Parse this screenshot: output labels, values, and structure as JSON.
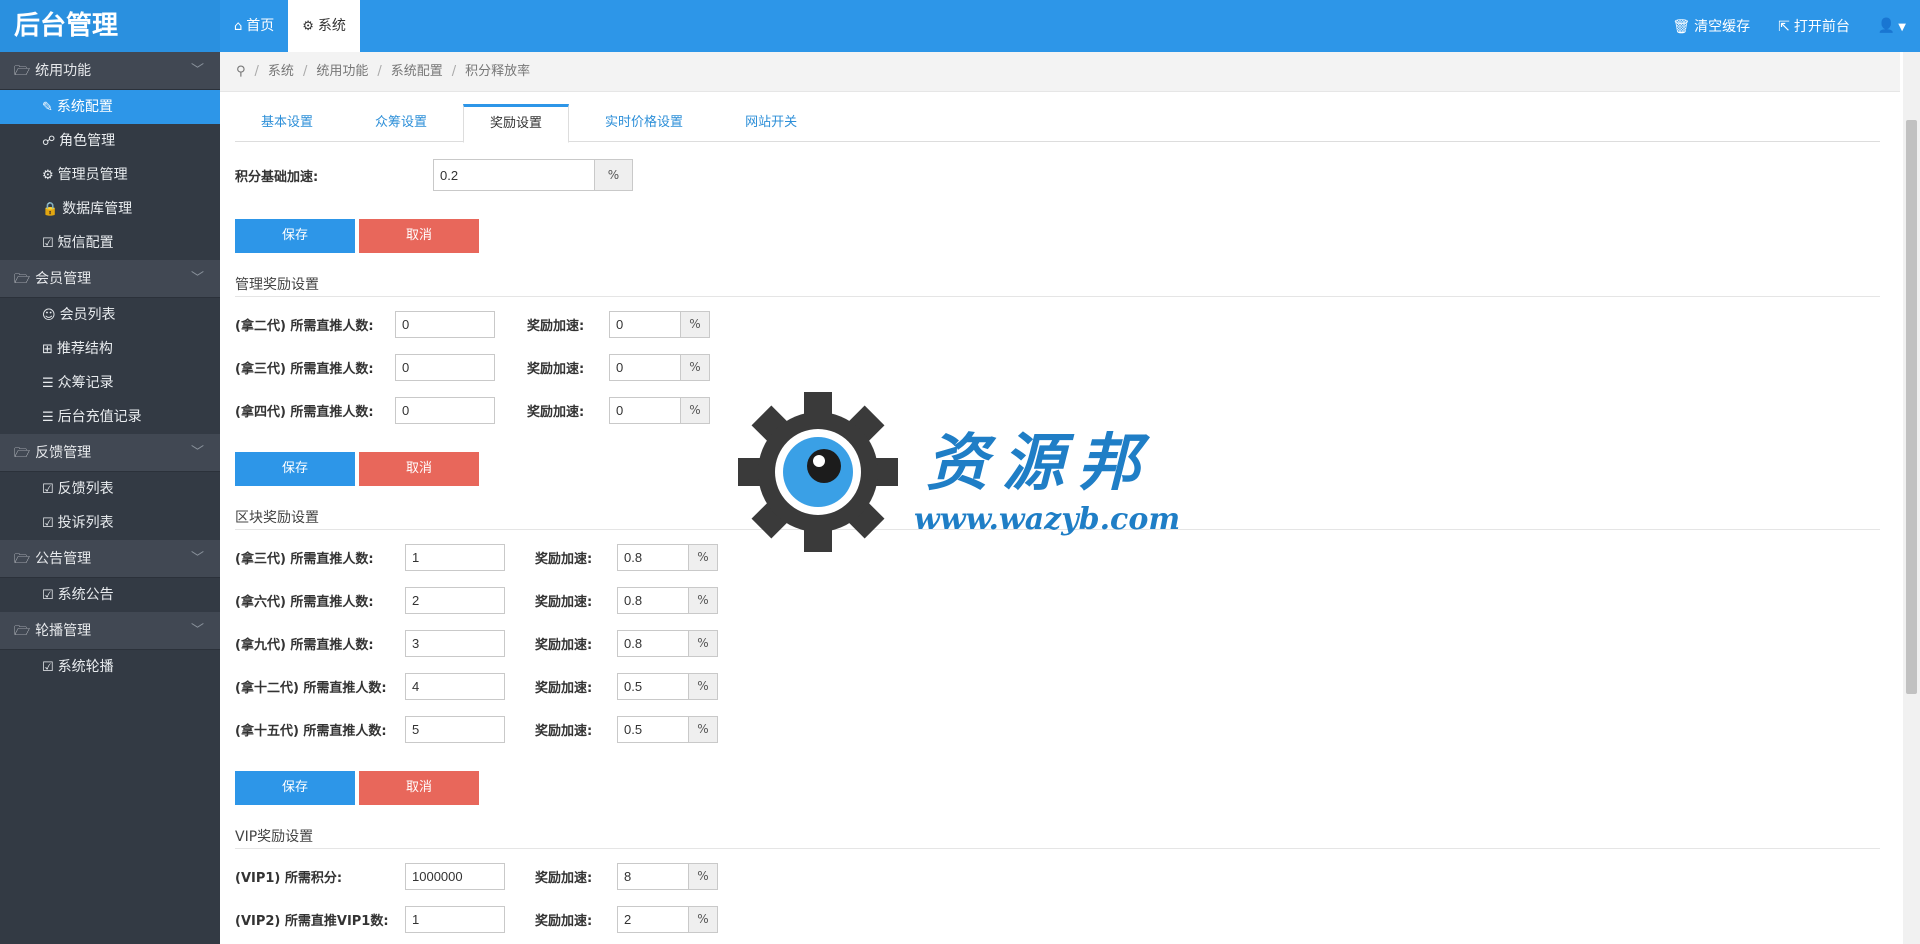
{
  "brand": "后台管理",
  "top_tabs": [
    {
      "icon": "home-icon",
      "label": "首页"
    },
    {
      "icon": "gear-icon",
      "label": "系统"
    }
  ],
  "top_actions": {
    "clear_cache": "清空缓存",
    "open_frontend": "打开前台"
  },
  "sidebar": {
    "groups": [
      {
        "label": "统用功能",
        "items": [
          {
            "icon": "wrench-icon",
            "label": "系统配置",
            "active": true
          },
          {
            "icon": "sitemap-icon",
            "label": "角色管理"
          },
          {
            "icon": "cog-icon",
            "label": "管理员管理"
          },
          {
            "icon": "lock-icon",
            "label": "数据库管理"
          },
          {
            "icon": "edit-icon",
            "label": "短信配置"
          }
        ]
      },
      {
        "label": "会员管理",
        "items": [
          {
            "icon": "user-icon",
            "label": "会员列表"
          },
          {
            "icon": "grid-icon",
            "label": "推荐结构"
          },
          {
            "icon": "list-icon",
            "label": "众筹记录"
          },
          {
            "icon": "list-icon",
            "label": "后台充值记录"
          }
        ]
      },
      {
        "label": "反馈管理",
        "items": [
          {
            "icon": "edit-icon",
            "label": "反馈列表"
          },
          {
            "icon": "edit-icon",
            "label": "投诉列表"
          }
        ]
      },
      {
        "label": "公告管理",
        "items": [
          {
            "icon": "edit-icon",
            "label": "系统公告"
          }
        ]
      },
      {
        "label": "轮播管理",
        "items": [
          {
            "icon": "edit-icon",
            "label": "系统轮播"
          }
        ]
      }
    ]
  },
  "breadcrumb": [
    "系统",
    "统用功能",
    "系统配置",
    "积分释放率"
  ],
  "tabs": [
    "基本设置",
    "众筹设置",
    "奖励设置",
    "实时价格设置",
    "网站开关"
  ],
  "active_tab": "奖励设置",
  "base": {
    "label": "积分基础加速:",
    "value": "0.2",
    "unit": "%"
  },
  "buttons": {
    "save": "保存",
    "cancel": "取消"
  },
  "manage_reward": {
    "title": "管理奖励设置",
    "rows": [
      {
        "label": "(拿二代) 所需直推人数:",
        "count": "0",
        "rate_label": "奖励加速:",
        "rate": "0",
        "unit": "%"
      },
      {
        "label": "(拿三代) 所需直推人数:",
        "count": "0",
        "rate_label": "奖励加速:",
        "rate": "0",
        "unit": "%"
      },
      {
        "label": "(拿四代) 所需直推人数:",
        "count": "0",
        "rate_label": "奖励加速:",
        "rate": "0",
        "unit": "%"
      }
    ]
  },
  "block_reward": {
    "title": "区块奖励设置",
    "rows": [
      {
        "label": "(拿三代) 所需直推人数:",
        "count": "1",
        "rate_label": "奖励加速:",
        "rate": "0.8",
        "unit": "%"
      },
      {
        "label": "(拿六代) 所需直推人数:",
        "count": "2",
        "rate_label": "奖励加速:",
        "rate": "0.8",
        "unit": "%"
      },
      {
        "label": "(拿九代) 所需直推人数:",
        "count": "3",
        "rate_label": "奖励加速:",
        "rate": "0.8",
        "unit": "%"
      },
      {
        "label": "(拿十二代) 所需直推人数:",
        "count": "4",
        "rate_label": "奖励加速:",
        "rate": "0.5",
        "unit": "%"
      },
      {
        "label": "(拿十五代) 所需直推人数:",
        "count": "5",
        "rate_label": "奖励加速:",
        "rate": "0.5",
        "unit": "%"
      }
    ]
  },
  "vip_reward": {
    "title": "VIP奖励设置",
    "rows": [
      {
        "label": "(VIP1) 所需积分:",
        "count": "1000000",
        "rate_label": "奖励加速:",
        "rate": "8",
        "unit": "%"
      },
      {
        "label": "(VIP2) 所需直推VIP1数:",
        "count": "1",
        "rate_label": "奖励加速:",
        "rate": "2",
        "unit": "%"
      }
    ]
  },
  "watermark": {
    "text": "资源邦",
    "url": "www.wazyb.com"
  },
  "colors": {
    "primary": "#2d96e8",
    "danger": "#e8675b",
    "sidebar": "#333a44"
  }
}
